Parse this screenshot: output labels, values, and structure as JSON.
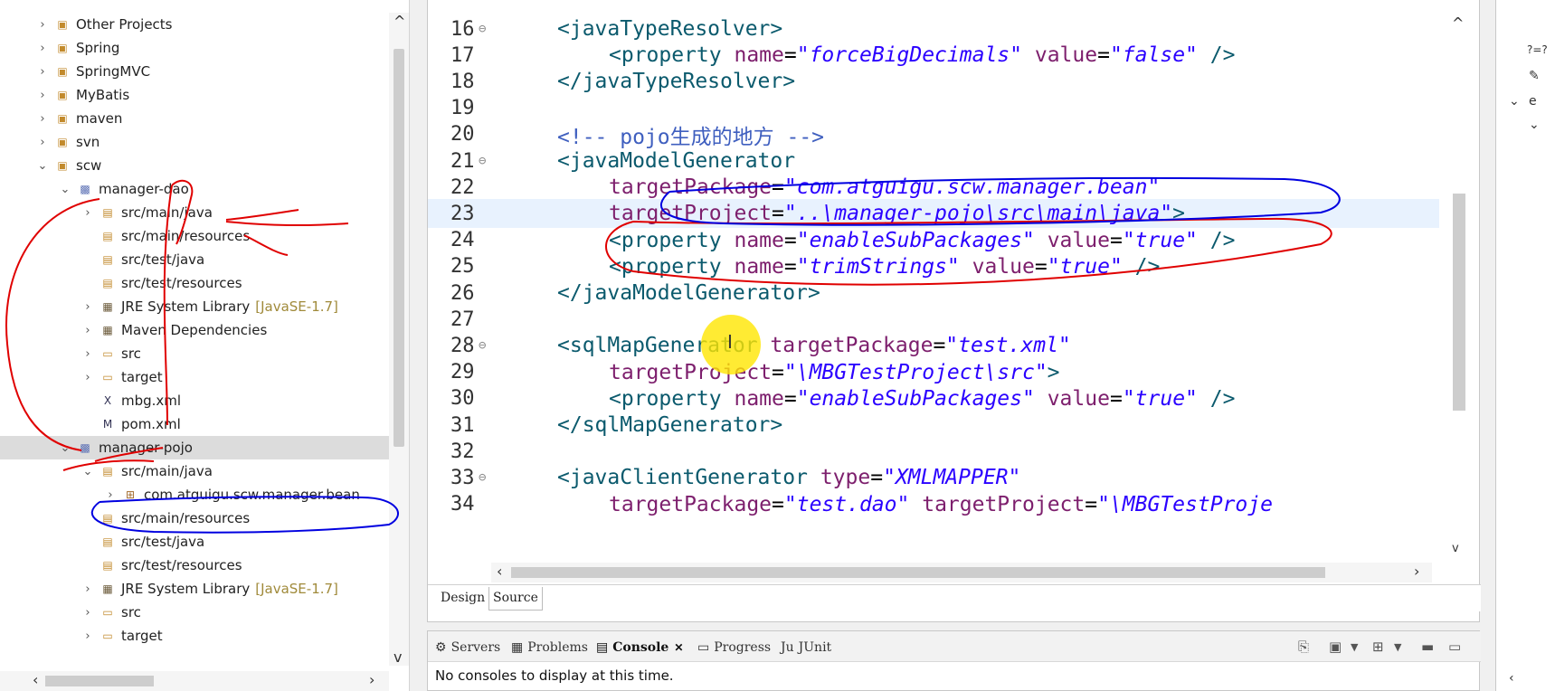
{
  "colors": {
    "tag": "#0b5a6d",
    "attribute": "#7d1f6d",
    "string": "#2a00ff",
    "comment": "#3f5fbf",
    "annotation_red": "#e00000",
    "annotation_blue": "#0000e0",
    "cursor_highlight": "#ffe600"
  },
  "left_panel": {
    "tree": [
      {
        "label": "Other Projects",
        "icon": "project-folder-icon",
        "arrow": "›"
      },
      {
        "label": "Spring",
        "icon": "project-folder-icon",
        "arrow": "›"
      },
      {
        "label": "SpringMVC",
        "icon": "project-folder-icon",
        "arrow": "›"
      },
      {
        "label": "MyBatis",
        "icon": "project-folder-icon",
        "arrow": "›"
      },
      {
        "label": "maven",
        "icon": "project-folder-icon",
        "arrow": "›"
      },
      {
        "label": "svn",
        "icon": "project-folder-icon",
        "arrow": "›"
      },
      {
        "label": "scw",
        "icon": "project-folder-icon",
        "arrow": "⌄"
      },
      {
        "label": "manager-dao",
        "icon": "maven-project-icon",
        "arrow": "⌄"
      },
      {
        "label": "src/main/java",
        "icon": "source-folder-icon",
        "arrow": "›"
      },
      {
        "label": "src/main/resources",
        "icon": "source-folder-icon",
        "arrow": ""
      },
      {
        "label": "src/test/java",
        "icon": "source-folder-icon",
        "arrow": ""
      },
      {
        "label": "src/test/resources",
        "icon": "source-folder-icon",
        "arrow": ""
      },
      {
        "label": "JRE System Library",
        "suffix": "[JavaSE-1.7]",
        "icon": "library-icon",
        "arrow": "›"
      },
      {
        "label": "Maven Dependencies",
        "icon": "library-icon",
        "arrow": "›"
      },
      {
        "label": "src",
        "icon": "folder-icon",
        "arrow": "›"
      },
      {
        "label": "target",
        "icon": "folder-icon",
        "arrow": "›"
      },
      {
        "label": "mbg.xml",
        "icon": "xml-file-icon",
        "arrow": ""
      },
      {
        "label": "pom.xml",
        "icon": "maven-pom-icon",
        "arrow": ""
      },
      {
        "label": "manager-pojo",
        "icon": "maven-project-icon",
        "arrow": "⌄"
      },
      {
        "label": "src/main/java",
        "icon": "source-folder-icon",
        "arrow": "⌄"
      },
      {
        "label": "com.atguigu.scw.manager.bean",
        "icon": "package-icon",
        "arrow": "›"
      },
      {
        "label": "src/main/resources",
        "icon": "source-folder-icon",
        "arrow": ""
      },
      {
        "label": "src/test/java",
        "icon": "source-folder-icon",
        "arrow": ""
      },
      {
        "label": "src/test/resources",
        "icon": "source-folder-icon",
        "arrow": ""
      },
      {
        "label": "JRE System Library",
        "suffix": "[JavaSE-1.7]",
        "icon": "library-icon",
        "arrow": "›"
      },
      {
        "label": "src",
        "icon": "folder-icon",
        "arrow": "›"
      },
      {
        "label": "target",
        "icon": "folder-icon",
        "arrow": "›"
      }
    ]
  },
  "editor": {
    "lines": [
      {
        "n": "16",
        "fold": true,
        "indent": "",
        "code": "<javaTypeResolver>"
      },
      {
        "n": "17",
        "fold": false,
        "indent": "  ",
        "code": "<property name=\"forceBigDecimals\" value=\"false\" />"
      },
      {
        "n": "18",
        "fold": false,
        "indent": "",
        "code": "</javaTypeResolver>"
      },
      {
        "n": "19",
        "fold": false,
        "indent": "",
        "code": ""
      },
      {
        "n": "20",
        "fold": false,
        "indent": "",
        "code": "<!-- pojo生成的地方 -->"
      },
      {
        "n": "21",
        "fold": true,
        "indent": "",
        "code": "<javaModelGenerator"
      },
      {
        "n": "22",
        "fold": false,
        "indent": "  ",
        "code": "targetPackage=\"com.atguigu.scw.manager.bean\""
      },
      {
        "n": "23",
        "fold": false,
        "indent": "  ",
        "code": "targetProject=\"..\\manager-pojo\\src\\main\\java\">"
      },
      {
        "n": "24",
        "fold": false,
        "indent": "  ",
        "code": "<property name=\"enableSubPackages\" value=\"true\" />"
      },
      {
        "n": "25",
        "fold": false,
        "indent": "  ",
        "code": "<property name=\"trimStrings\" value=\"true\" />"
      },
      {
        "n": "26",
        "fold": false,
        "indent": "",
        "code": "</javaModelGenerator>"
      },
      {
        "n": "27",
        "fold": false,
        "indent": "",
        "code": ""
      },
      {
        "n": "28",
        "fold": true,
        "indent": "",
        "code": "<sqlMapGenerator targetPackage=\"test.xml\""
      },
      {
        "n": "29",
        "fold": false,
        "indent": "  ",
        "code": "targetProject=\"\\MBGTestProject\\src\">"
      },
      {
        "n": "30",
        "fold": false,
        "indent": "  ",
        "code": "<property name=\"enableSubPackages\" value=\"true\" />"
      },
      {
        "n": "31",
        "fold": false,
        "indent": "",
        "code": "</sqlMapGenerator>"
      },
      {
        "n": "32",
        "fold": false,
        "indent": "",
        "code": ""
      },
      {
        "n": "33",
        "fold": true,
        "indent": "",
        "code": "<javaClientGenerator type=\"XMLMAPPER\""
      },
      {
        "n": "34",
        "fold": false,
        "indent": "  ",
        "code": "targetPackage=\"test.dao\" targetProject=\"\\MBGTestProje"
      }
    ],
    "bottom_tabs": {
      "design": "Design",
      "source": "Source"
    }
  },
  "console_view": {
    "tabs": [
      {
        "label": "Servers",
        "icon": "servers-icon"
      },
      {
        "label": "Problems",
        "icon": "problems-icon"
      },
      {
        "label": "Console",
        "icon": "console-icon",
        "active": true
      },
      {
        "label": "Progress",
        "icon": "progress-icon"
      },
      {
        "label": "JUnit",
        "icon": "junit-icon"
      }
    ],
    "message": "No consoles to display at this time."
  },
  "right_panel": {
    "items": [
      "?=?"
    ]
  }
}
